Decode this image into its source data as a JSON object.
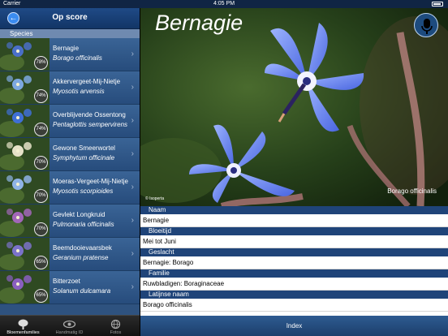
{
  "statusbar": {
    "carrier": "Carrier",
    "time": "4:05 PM"
  },
  "navbar": {
    "title": "Op score",
    "back_icon": "back-arrow-icon",
    "info_icon": "info-icon",
    "info_glyph": "i",
    "back_glyph": "←"
  },
  "section": "Species",
  "species": [
    {
      "name": "Bernagie",
      "latin": "Borago officinalis",
      "pct": "78%",
      "color": "#4a6fc8"
    },
    {
      "name": "Akkervergeet-Mij-Nietje",
      "latin": "Myosotis arvensis",
      "pct": "74%",
      "color": "#7da8e0"
    },
    {
      "name": "Overblijvende Ossentong",
      "latin": "Pentaglottis sempervirens",
      "pct": "74%",
      "color": "#3f6fd6"
    },
    {
      "name": "Gewone Smeerwortel",
      "latin": "Symphytum officinale",
      "pct": "70%",
      "color": "#e6e2c8"
    },
    {
      "name": "Moeras-Vergeet-Mij-Nietje",
      "latin": "Myosotis scorpioides",
      "pct": "70%",
      "color": "#8fb3e6"
    },
    {
      "name": "Gevlekt Longkruid",
      "latin": "Pulmonaria officinalis",
      "pct": "70%",
      "color": "#a266b8"
    },
    {
      "name": "Beemdooievaarsbek",
      "latin": "Geranium pratense",
      "pct": "65%",
      "color": "#7b72c9"
    },
    {
      "name": "Bitterzoet",
      "latin": "Solanum dulcamara",
      "pct": "65%",
      "color": "#8a5fc0"
    }
  ],
  "tabs": [
    {
      "label": "Bloemenfamilies",
      "icon": "tree-icon",
      "selected": true
    },
    {
      "label": "Handmatig ID",
      "icon": "eye-icon",
      "selected": false
    },
    {
      "label": "Fotos",
      "icon": "globe-icon",
      "selected": false
    }
  ],
  "detail": {
    "title": "Bernagie",
    "caption": "Borago officinalis",
    "credit": "© Isoperta",
    "mic_icon": "microphone-icon",
    "fields": [
      {
        "label": "Naam",
        "value": "Bernagie"
      },
      {
        "label": "Bloeitijd",
        "value": "Mei tot Juni"
      },
      {
        "label": "Geslacht",
        "value": "Bernagie: Borago"
      },
      {
        "label": "Familie",
        "value": "Ruwbladigen: Boraginaceae"
      },
      {
        "label": "Latijnse naam",
        "value": "Borago officinalis"
      }
    ],
    "index_label": "Index"
  },
  "colors": {
    "nav": "#123566",
    "list": "#2e527f",
    "header": "#1f4479",
    "petal": "#5b7ff0"
  }
}
